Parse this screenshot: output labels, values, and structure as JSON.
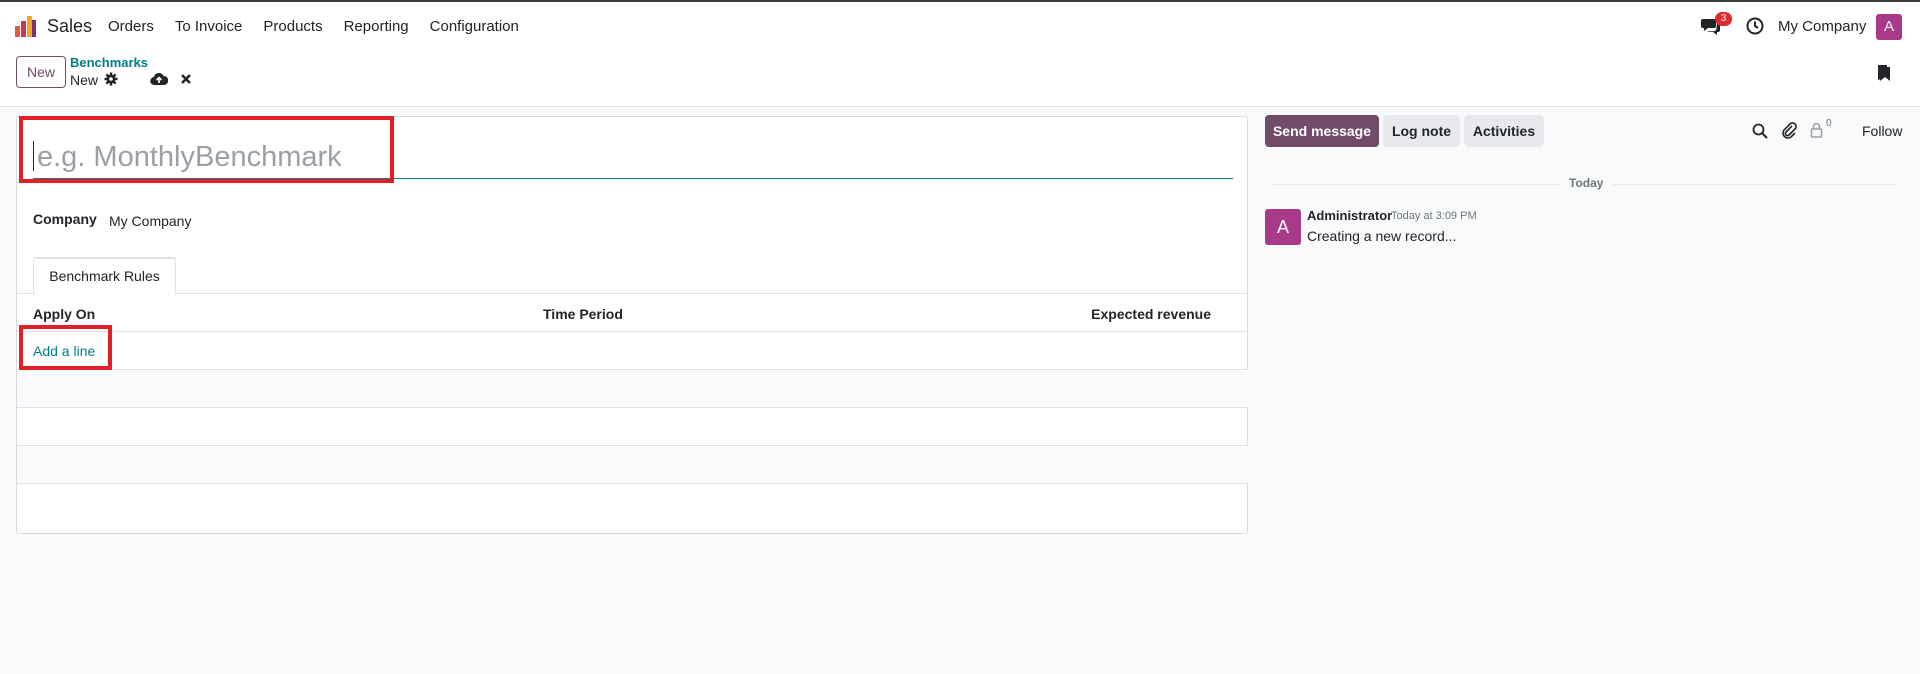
{
  "navbar": {
    "app_name": "Sales",
    "menu": [
      "Orders",
      "To Invoice",
      "Products",
      "Reporting",
      "Configuration"
    ],
    "message_badge": "3",
    "company": "My Company",
    "avatar_letter": "A"
  },
  "control_panel": {
    "new_label": "New",
    "breadcrumb": "Benchmarks",
    "record_name": "New"
  },
  "form": {
    "name_placeholder": "e.g. MonthlyBenchmark",
    "name_value": "",
    "company_label": "Company",
    "company_value": "My Company",
    "tab_label": "Benchmark Rules",
    "columns": [
      "Apply On",
      "Time Period",
      "Expected revenue"
    ],
    "add_line_label": "Add a line"
  },
  "chatter": {
    "send_message_label": "Send message",
    "log_note_label": "Log note",
    "activities_label": "Activities",
    "follower_count": "0",
    "follow_label": "Follow",
    "date_separator": "Today",
    "messages": [
      {
        "avatar_letter": "A",
        "author": "Administrator",
        "date": "Today at 3:09 PM",
        "body": "Creating a new record..."
      }
    ]
  },
  "colors": {
    "brand": "#714b67",
    "accent": "#017e84",
    "avatar": "#a93a8b",
    "highlight": "#e41e26",
    "badge": "#e02a2f"
  }
}
